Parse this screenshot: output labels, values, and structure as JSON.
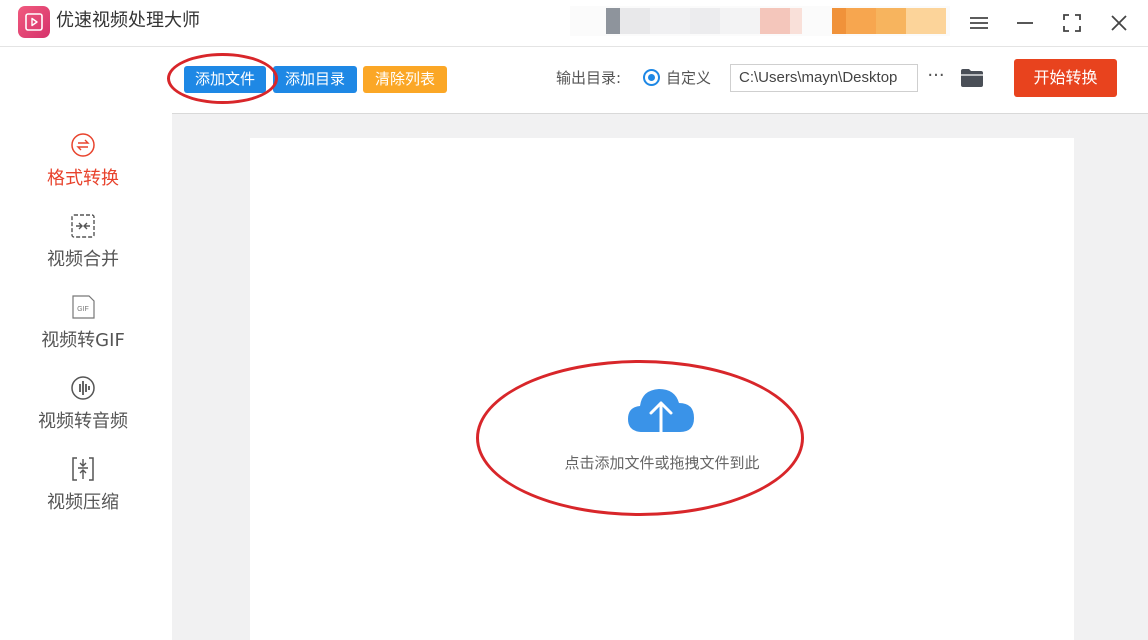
{
  "app": {
    "title": "优速视频处理大师",
    "brand_color": "#e0356b"
  },
  "window_controls": {
    "menu_icon": "hamburger-icon",
    "minimize_icon": "minimize-icon",
    "maximize_icon": "maximize-icon",
    "close_icon": "close-icon"
  },
  "sidebar": {
    "items": [
      {
        "label": "格式转换",
        "icon": "format-convert-icon",
        "active": true
      },
      {
        "label": "视频合并",
        "icon": "merge-icon",
        "active": false
      },
      {
        "label": "视频转GIF",
        "icon": "gif-icon",
        "active": false
      },
      {
        "label": "视频转音频",
        "icon": "audio-icon",
        "active": false
      },
      {
        "label": "视频压缩",
        "icon": "compress-icon",
        "active": false
      }
    ],
    "active_color": "#e8432d"
  },
  "toolbar": {
    "add_file": "添加文件",
    "add_folder": "添加目录",
    "clear_list": "清除列表",
    "output_label": "输出目录:",
    "radio_custom": "自定义",
    "output_path": "C:\\Users\\mayn\\Desktop",
    "more_label": "···",
    "start": "开始转换",
    "accent_blue": "#1e88e5",
    "accent_orange": "#fba726",
    "start_color": "#e8431e"
  },
  "dropzone": {
    "hint": "点击添加文件或拖拽文件到此",
    "icon": "cloud-upload-icon"
  },
  "annotations": {
    "circle_color": "#d8262a"
  }
}
